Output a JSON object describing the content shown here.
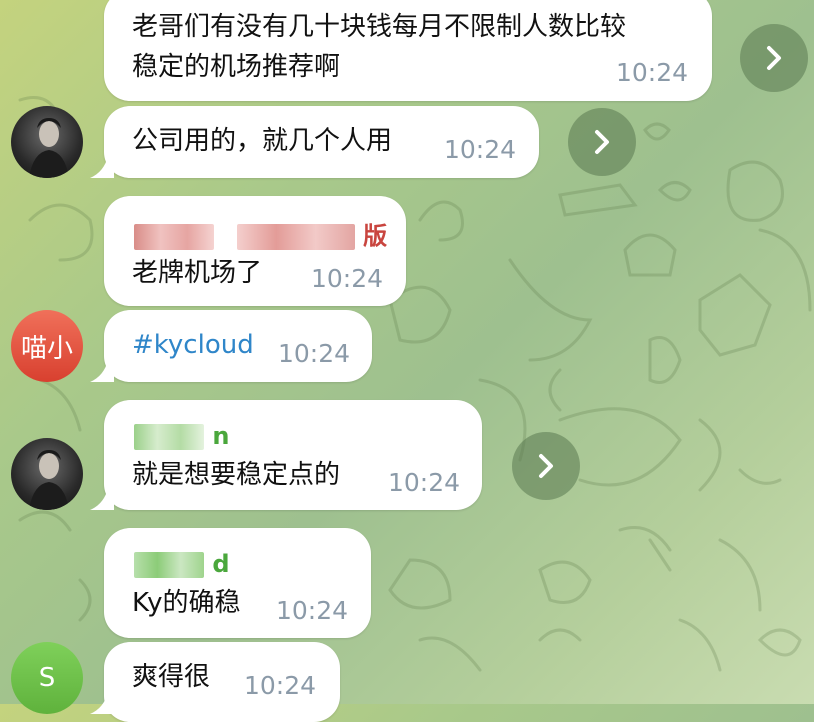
{
  "messages": [
    {
      "text_line1": "老哥们有没有几十块钱每月不限制人数比较",
      "text_line2": "稳定的机场推荐啊",
      "time": "10:24"
    },
    {
      "text": "公司用的，就几个人用",
      "time": "10:24"
    },
    {
      "sender_fragment": "版",
      "text": "老牌机场了",
      "time": "10:24"
    },
    {
      "text": "#kycloud",
      "time": "10:24"
    },
    {
      "sender_fragment": "n",
      "text": "就是想要稳定点的",
      "time": "10:24"
    },
    {
      "sender_fragment": "d",
      "text": "Ky的确稳",
      "time": "10:24"
    },
    {
      "text": "爽得很",
      "time": "10:24"
    }
  ],
  "avatars": {
    "miao_label": "喵小",
    "s_label": "S"
  },
  "colors": {
    "sender_red": "#c9453f",
    "sender_green": "#4aa73c",
    "link_blue": "#2f86c9",
    "avatar_red": "#e4533f",
    "avatar_green": "#6cbd45"
  },
  "icons": [
    "forward-arrow-icon",
    "person-avatar-photo"
  ]
}
